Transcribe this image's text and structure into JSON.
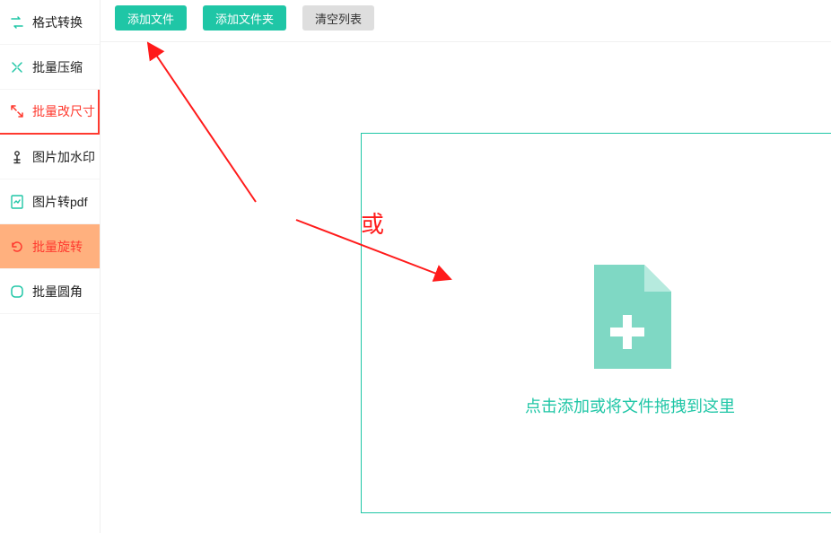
{
  "sidebar": {
    "items": [
      {
        "label": "格式转换",
        "icon": "convert-icon"
      },
      {
        "label": "批量压缩",
        "icon": "compress-icon"
      },
      {
        "label": "批量改尺寸",
        "icon": "resize-icon"
      },
      {
        "label": "图片加水印",
        "icon": "watermark-icon"
      },
      {
        "label": "图片转pdf",
        "icon": "pdf-icon"
      },
      {
        "label": "批量旋转",
        "icon": "rotate-icon"
      },
      {
        "label": "批量圆角",
        "icon": "round-icon"
      }
    ]
  },
  "toolbar": {
    "add_file_label": "添加文件",
    "add_folder_label": "添加文件夹",
    "clear_list_label": "清空列表"
  },
  "dropzone": {
    "hint": "点击添加或将文件拖拽到这里"
  },
  "annotation": {
    "or_text": "或"
  },
  "colors": {
    "accent": "#1fc6a6",
    "danger": "#ff1a1a",
    "highlight_bg": "#ffb07e"
  }
}
